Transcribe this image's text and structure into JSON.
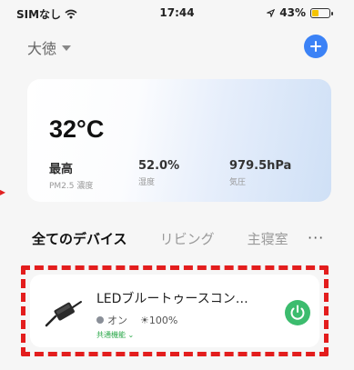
{
  "status_bar": {
    "carrier": "SIMなし",
    "time": "17:44",
    "battery_percent": "43%",
    "battery_level": 0.43
  },
  "header": {
    "home_name": "大徳"
  },
  "weather": {
    "temperature": "32°C",
    "stats": [
      {
        "value": "最高",
        "label": "PM2.5 濃度"
      },
      {
        "value": "52.0%",
        "label": "湿度"
      },
      {
        "value": "979.5hPa",
        "label": "気圧"
      }
    ]
  },
  "tabs": [
    {
      "label": "全てのデバイス",
      "active": true
    },
    {
      "label": "リビング",
      "active": false
    },
    {
      "label": "主寝室",
      "active": false
    }
  ],
  "more_label": "···",
  "device": {
    "name": "LEDブルートゥースコン…",
    "state": "オン",
    "brightness": "☀100%",
    "common_functions": "共通機能"
  },
  "colors": {
    "accent_blue": "#3b82f6",
    "power_green": "#3cbc6e",
    "highlight_red": "#e31d1d",
    "battery_yellow": "#f4c400"
  }
}
